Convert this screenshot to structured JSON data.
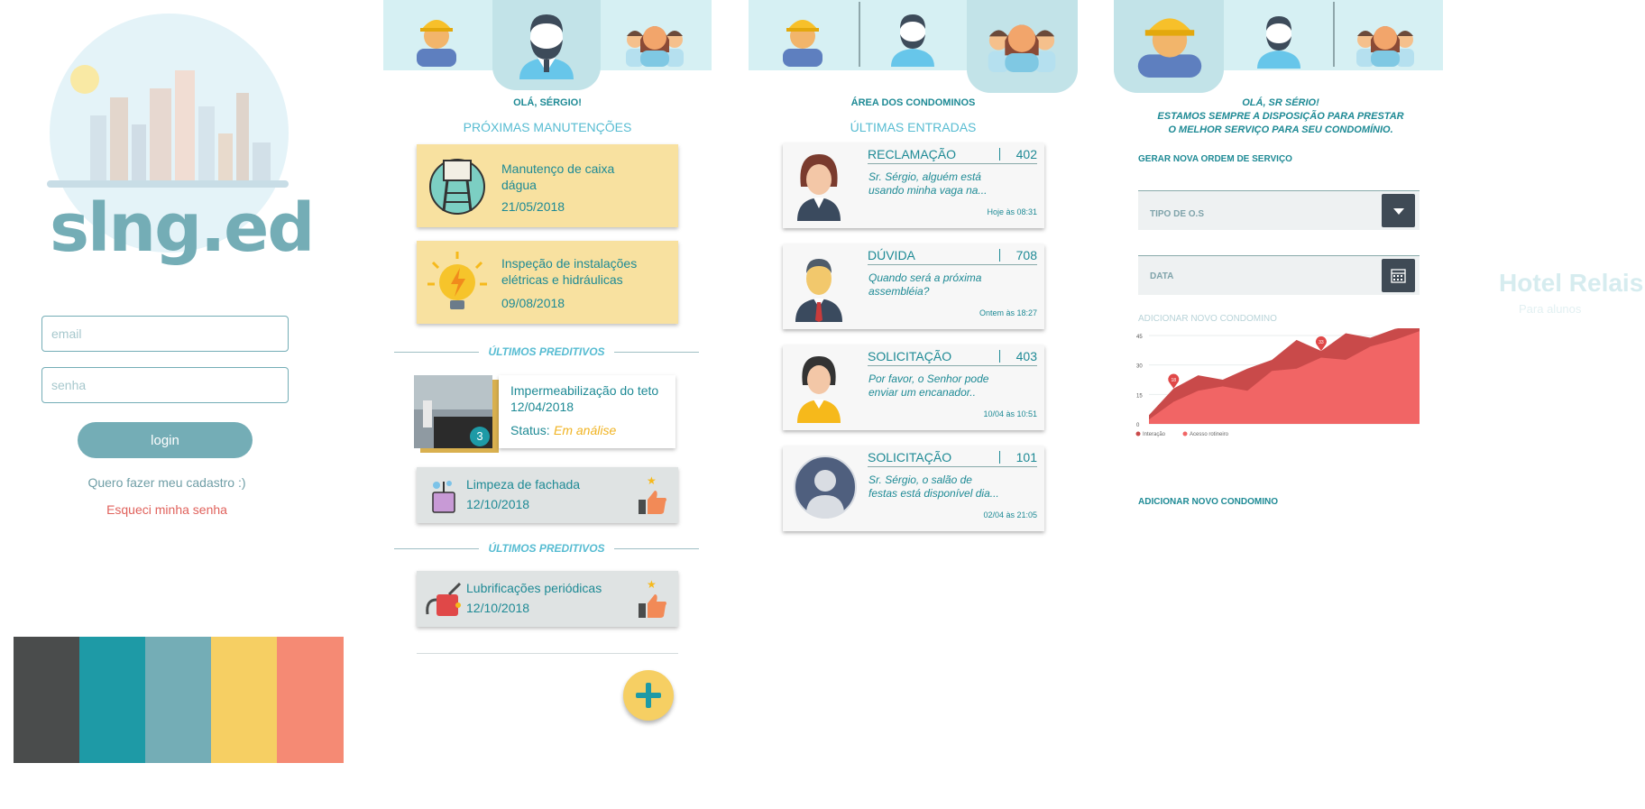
{
  "login": {
    "logo_text": "slng.ed",
    "email_placeholder": "email",
    "password_placeholder": "senha",
    "login_label": "login",
    "signup_link": "Quero fazer meu cadastro :)",
    "forgot_link": "Esqueci minha senha"
  },
  "palette": [
    "#4a4c4c",
    "#1e9aa6",
    "#74adb6",
    "#f6cf63",
    "#f58a74"
  ],
  "screen1": {
    "greeting": "OLÁ, SÉRGIO!",
    "section_title": "PRÓXIMAS MANUTENÇÕES",
    "maintenances": [
      {
        "title": "Manutenço de caixa dágua",
        "date": "21/05/2018",
        "icon": "water-tank-icon"
      },
      {
        "title": "Inspeção de instalações elétricas e hidráulicas",
        "date": "09/08/2018",
        "icon": "lightbulb-icon"
      }
    ],
    "predictive_label_1": "ÚLTIMOS PREDITIVOS",
    "predictive_featured": {
      "title": "Impermeabilização do teto",
      "date": "12/04/2018",
      "status_label": "Status:",
      "status_value": "Em análise",
      "badge": "3"
    },
    "predictive_item_1": {
      "title": "Limpeza de fachada",
      "date": "12/10/2018"
    },
    "predictive_label_2": "ÚLTIMOS PREDITIVOS",
    "predictive_item_2": {
      "title": "Lubrificações periódicas",
      "date": "12/10/2018"
    },
    "fab_label": "+"
  },
  "screen2": {
    "title": "ÁREA DOS CONDOMINOS",
    "section_title": "ÚLTIMAS ENTRADAS",
    "entries": [
      {
        "type": "RECLAMAÇÃO",
        "number": "402",
        "message": "Sr. Sérgio, alguém está usando minha vaga na...",
        "time": "Hoje às 08:31"
      },
      {
        "type": "DÚVIDA",
        "number": "708",
        "message": "Quando será a próxima assembléia?",
        "time": "Ontem às 18:27"
      },
      {
        "type": "SOLICITAÇÃO",
        "number": "403",
        "message": "Por favor, o Senhor pode enviar um encanador..",
        "time": "10/04 às 10:51"
      },
      {
        "type": "SOLICITAÇÃO",
        "number": "101",
        "message": "Sr. Sérgio, o salão de festas está disponível dia...",
        "time": "02/04 às 21:05"
      }
    ]
  },
  "screen3": {
    "greeting_1": "OLÁ, SR SÉRIO!",
    "greeting_2": "ESTAMOS SEMPRE A DISPOSIÇÃO PARA PRESTAR",
    "greeting_3": "O MELHOR SERVIÇO PARA SEU CONDOMÍNIO.",
    "new_order_label": "GERAR NOVA ORDEM DE SERVIÇO",
    "os_type_label": "TIPO DE O.S",
    "date_label": "DATA",
    "add_condo_faded": "ADICIONAR NOVO CONDOMINO",
    "add_condo_link": "ADICIONAR NOVO CONDOMINO",
    "chart_legend_1": "Interação",
    "chart_legend_2": "Acesso rotineiro",
    "ghost_title": "Hotel Relais",
    "ghost_sub": "Para alunos"
  },
  "chart_data": {
    "type": "area",
    "ylim": [
      0,
      40
    ],
    "yticks": [
      "0",
      "15",
      "30",
      "45"
    ],
    "series": [
      {
        "name": "Interação",
        "color": "#c94a4a",
        "values": [
          4,
          16,
          22,
          20,
          25,
          29,
          38,
          33,
          41,
          39,
          43,
          45
        ]
      },
      {
        "name": "Acesso rotineiro",
        "color": "#f16565",
        "values": [
          2,
          10,
          15,
          17,
          15,
          24,
          25,
          30,
          29,
          35,
          38,
          42
        ]
      }
    ],
    "markers": [
      {
        "label": "18",
        "index": 1
      },
      {
        "label": "33",
        "index": 7
      }
    ]
  }
}
